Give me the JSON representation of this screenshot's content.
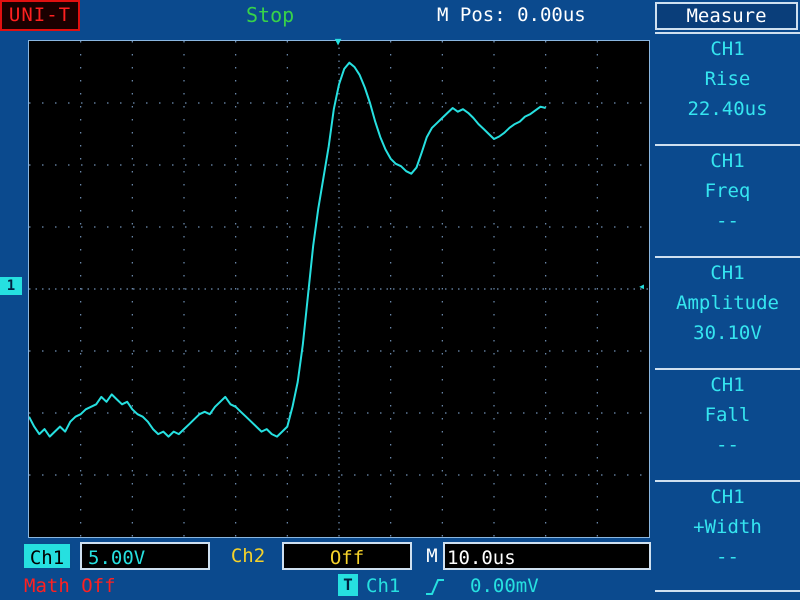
{
  "header": {
    "brand": "UNI-T",
    "status": "Stop",
    "m_pos": "M Pos: 0.00us"
  },
  "menu": {
    "title": "Measure",
    "items": [
      {
        "source": "CH1",
        "name": "Rise",
        "value": "22.40us"
      },
      {
        "source": "CH1",
        "name": "Freq",
        "value": "--"
      },
      {
        "source": "CH1",
        "name": "Amplitude",
        "value": "30.10V"
      },
      {
        "source": "CH1",
        "name": "Fall",
        "value": "--"
      },
      {
        "source": "CH1",
        "name": "+Width",
        "value": "--"
      }
    ]
  },
  "markers": {
    "channel1": "1",
    "trigger_right": "◂",
    "trigger_top": "▼"
  },
  "bottom": {
    "ch1_label": "Ch1",
    "ch1_scale": "5.00V",
    "ch2_label": "Ch2",
    "ch2_scale": "Off",
    "timebase_label": "M",
    "timebase_value": "10.0us",
    "math": "Math Off",
    "trigger_icon": "T",
    "trigger_source": "Ch1",
    "trigger_edge_icon": "rising-edge",
    "trigger_level": "0.00mV"
  },
  "colors": {
    "background": "#0b4a8e",
    "ch1": "#26e0e0",
    "ch2": "#f5d22a",
    "math": "#ff2020",
    "status": "#37d24a",
    "grid": "#6f8fb5"
  },
  "chart_data": {
    "type": "line",
    "title": "",
    "xlabel": "",
    "ylabel": "",
    "xlim": [
      0,
      12
    ],
    "ylim": [
      -4,
      4
    ],
    "grid": true,
    "series": [
      {
        "values": [
          [
            0.0,
            -2.06
          ],
          [
            0.1,
            -2.22
          ],
          [
            0.2,
            -2.34
          ],
          [
            0.3,
            -2.26
          ],
          [
            0.4,
            -2.38
          ],
          [
            0.5,
            -2.3
          ],
          [
            0.6,
            -2.22
          ],
          [
            0.7,
            -2.3
          ],
          [
            0.8,
            -2.14
          ],
          [
            0.9,
            -2.06
          ],
          [
            1.0,
            -2.02
          ],
          [
            1.1,
            -1.94
          ],
          [
            1.2,
            -1.9
          ],
          [
            1.3,
            -1.86
          ],
          [
            1.4,
            -1.74
          ],
          [
            1.5,
            -1.82
          ],
          [
            1.6,
            -1.7
          ],
          [
            1.7,
            -1.78
          ],
          [
            1.8,
            -1.86
          ],
          [
            1.9,
            -1.82
          ],
          [
            2.0,
            -1.94
          ],
          [
            2.1,
            -2.02
          ],
          [
            2.2,
            -2.06
          ],
          [
            2.3,
            -2.14
          ],
          [
            2.4,
            -2.26
          ],
          [
            2.5,
            -2.34
          ],
          [
            2.6,
            -2.3
          ],
          [
            2.7,
            -2.38
          ],
          [
            2.8,
            -2.3
          ],
          [
            2.9,
            -2.34
          ],
          [
            3.0,
            -2.26
          ],
          [
            3.1,
            -2.18
          ],
          [
            3.2,
            -2.1
          ],
          [
            3.3,
            -2.02
          ],
          [
            3.4,
            -1.98
          ],
          [
            3.5,
            -2.02
          ],
          [
            3.6,
            -1.9
          ],
          [
            3.7,
            -1.82
          ],
          [
            3.8,
            -1.74
          ],
          [
            3.9,
            -1.86
          ],
          [
            4.0,
            -1.9
          ],
          [
            4.1,
            -1.98
          ],
          [
            4.2,
            -2.06
          ],
          [
            4.3,
            -2.14
          ],
          [
            4.4,
            -2.22
          ],
          [
            4.5,
            -2.3
          ],
          [
            4.6,
            -2.26
          ],
          [
            4.7,
            -2.34
          ],
          [
            4.8,
            -2.38
          ],
          [
            4.9,
            -2.3
          ],
          [
            5.0,
            -2.22
          ],
          [
            5.1,
            -1.9
          ],
          [
            5.2,
            -1.5
          ],
          [
            5.3,
            -0.9
          ],
          [
            5.4,
            -0.1
          ],
          [
            5.5,
            0.7
          ],
          [
            5.6,
            1.3
          ],
          [
            5.7,
            1.8
          ],
          [
            5.8,
            2.3
          ],
          [
            5.9,
            2.9
          ],
          [
            6.0,
            3.3
          ],
          [
            6.1,
            3.55
          ],
          [
            6.2,
            3.65
          ],
          [
            6.3,
            3.58
          ],
          [
            6.4,
            3.45
          ],
          [
            6.5,
            3.25
          ],
          [
            6.6,
            3.0
          ],
          [
            6.7,
            2.7
          ],
          [
            6.8,
            2.45
          ],
          [
            6.9,
            2.25
          ],
          [
            7.0,
            2.1
          ],
          [
            7.1,
            2.02
          ],
          [
            7.2,
            1.98
          ],
          [
            7.3,
            1.9
          ],
          [
            7.4,
            1.86
          ],
          [
            7.5,
            1.96
          ],
          [
            7.6,
            2.2
          ],
          [
            7.7,
            2.45
          ],
          [
            7.8,
            2.6
          ],
          [
            7.9,
            2.68
          ],
          [
            8.0,
            2.76
          ],
          [
            8.1,
            2.84
          ],
          [
            8.2,
            2.92
          ],
          [
            8.3,
            2.86
          ],
          [
            8.4,
            2.9
          ],
          [
            8.5,
            2.84
          ],
          [
            8.6,
            2.76
          ],
          [
            8.7,
            2.66
          ],
          [
            8.8,
            2.58
          ],
          [
            8.9,
            2.5
          ],
          [
            9.0,
            2.42
          ],
          [
            9.1,
            2.46
          ],
          [
            9.2,
            2.52
          ],
          [
            9.3,
            2.6
          ],
          [
            9.4,
            2.66
          ],
          [
            9.5,
            2.7
          ],
          [
            9.6,
            2.78
          ],
          [
            9.7,
            2.82
          ],
          [
            9.8,
            2.88
          ],
          [
            9.9,
            2.94
          ],
          [
            10.0,
            2.92
          ]
        ]
      }
    ]
  }
}
